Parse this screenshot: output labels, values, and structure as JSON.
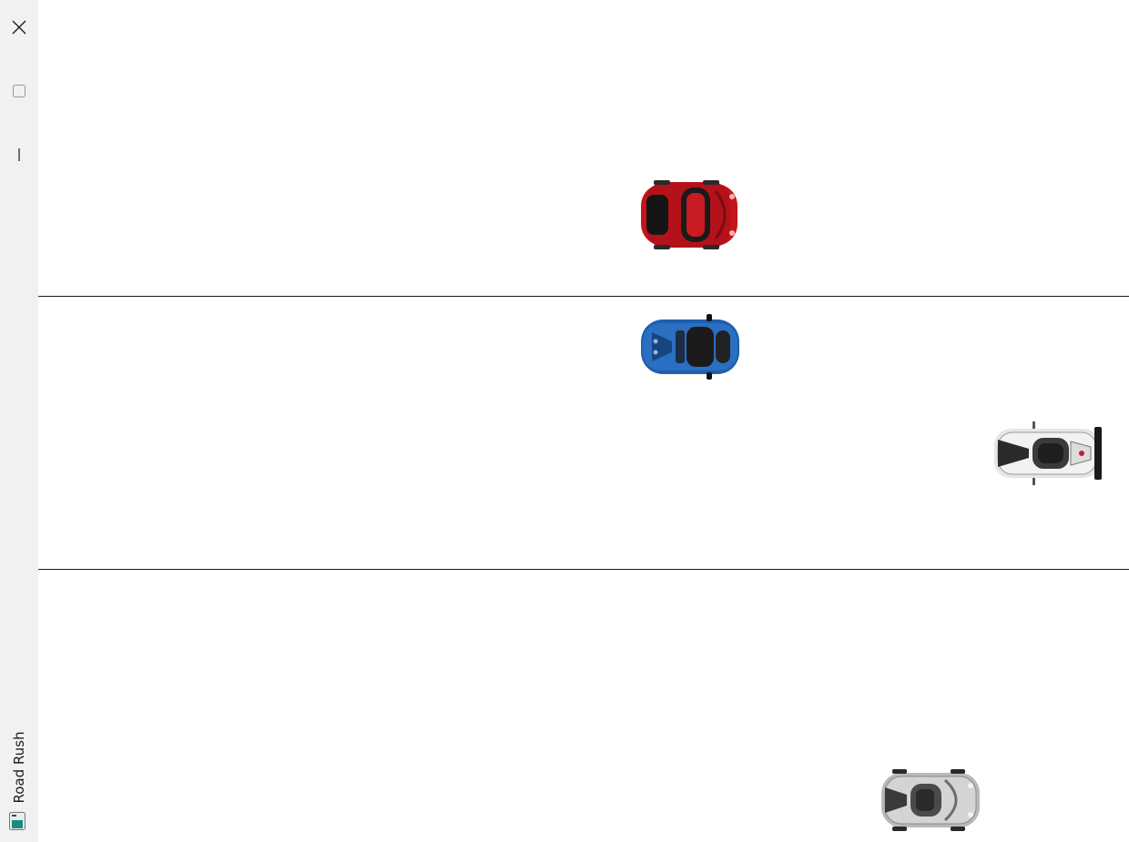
{
  "window": {
    "title": "Road Rush",
    "controls": {
      "close_icon": "close-icon",
      "maximize_icon": "maximize-icon",
      "minimize_icon": "minimize-icon"
    }
  },
  "game": {
    "lanes": 3,
    "cars": [
      {
        "name": "red-sports-car",
        "color": "#c4151c",
        "lane": 1
      },
      {
        "name": "blue-sports-car",
        "color": "#1f5fae",
        "lane": 2
      },
      {
        "name": "white-hypercar",
        "color": "#e6e6e6",
        "lane": 2
      },
      {
        "name": "silver-hypercar",
        "color": "#b9b9b9",
        "lane": 3
      }
    ]
  }
}
